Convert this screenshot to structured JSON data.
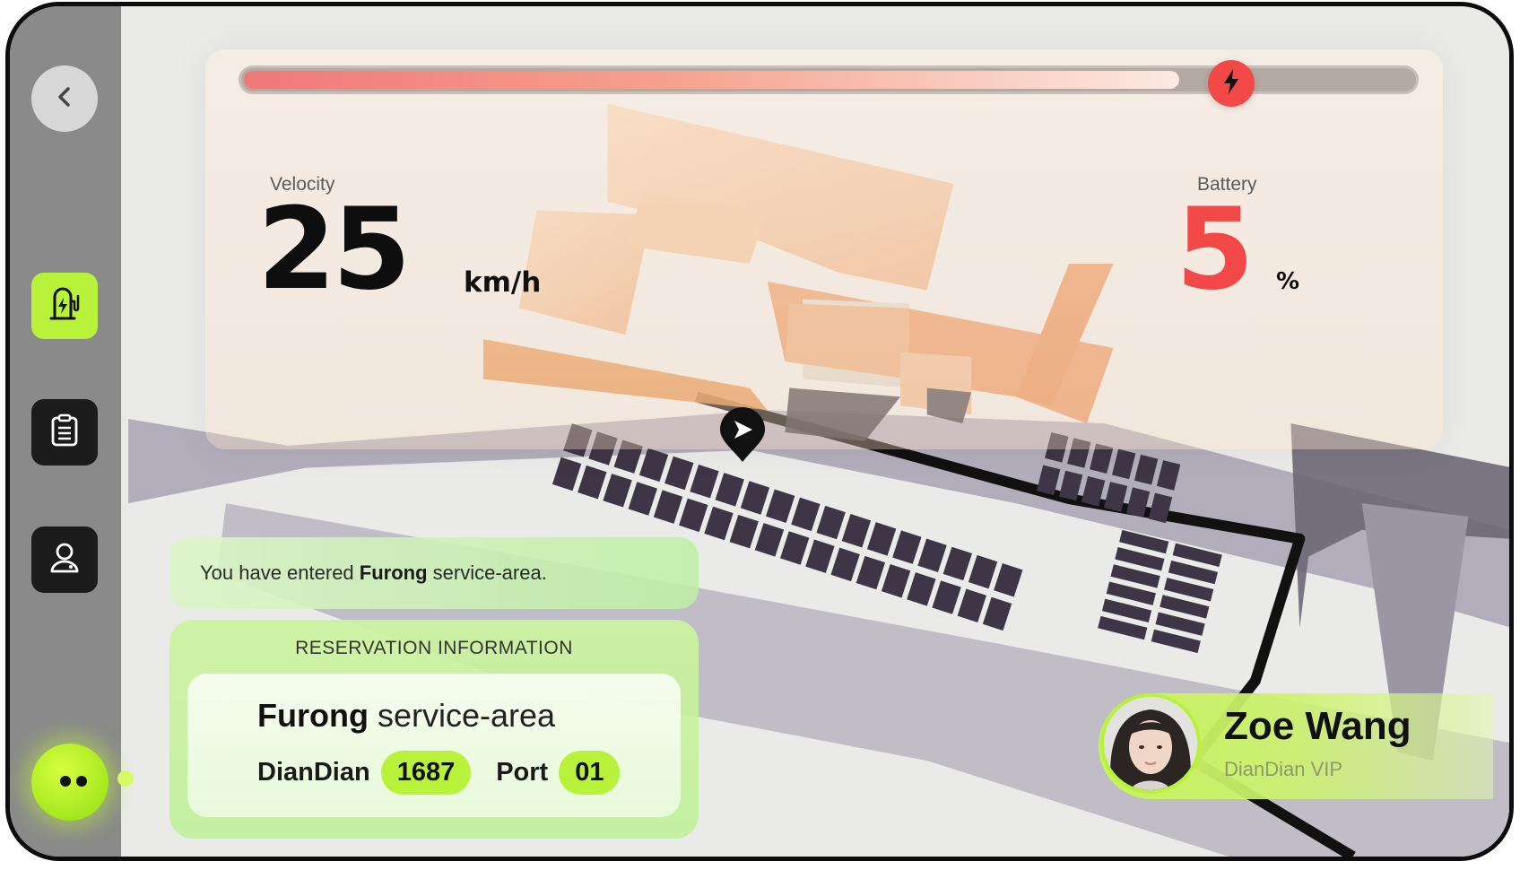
{
  "colors": {
    "accent": "#b9f23a",
    "alert": "#f24848",
    "sidebar": "#8a8a8a",
    "dark_button": "#1b1b1b"
  },
  "sidebar": {
    "items": [
      {
        "name": "back-button",
        "icon": "chevron-left-icon"
      },
      {
        "name": "charging-station-button",
        "icon": "charging-station-icon",
        "active": true
      },
      {
        "name": "clipboard-button",
        "icon": "clipboard-list-icon"
      },
      {
        "name": "profile-button",
        "icon": "user-icon"
      }
    ],
    "assistant_icon": "assistant-face-icon"
  },
  "charge_progress": {
    "fraction": 0.8,
    "icon": "lightning-bolt-icon"
  },
  "velocity": {
    "label": "Velocity",
    "value": "25",
    "unit": "km/h"
  },
  "battery": {
    "label": "Battery",
    "value": "5",
    "unit": "%"
  },
  "notice": {
    "prefix": "You have entered ",
    "place": "Furong",
    "suffix": " service-area."
  },
  "reservation": {
    "title": "RESERVATION INFORMATION",
    "area_name": "Furong",
    "area_suffix": " service-area",
    "station_label": "DianDian",
    "station_value": "1687",
    "port_label": "Port",
    "port_value": "01"
  },
  "user": {
    "name": "Zoe Wang",
    "tier": "DianDian VIP"
  },
  "map_pin_icon": "navigation-pin-icon"
}
